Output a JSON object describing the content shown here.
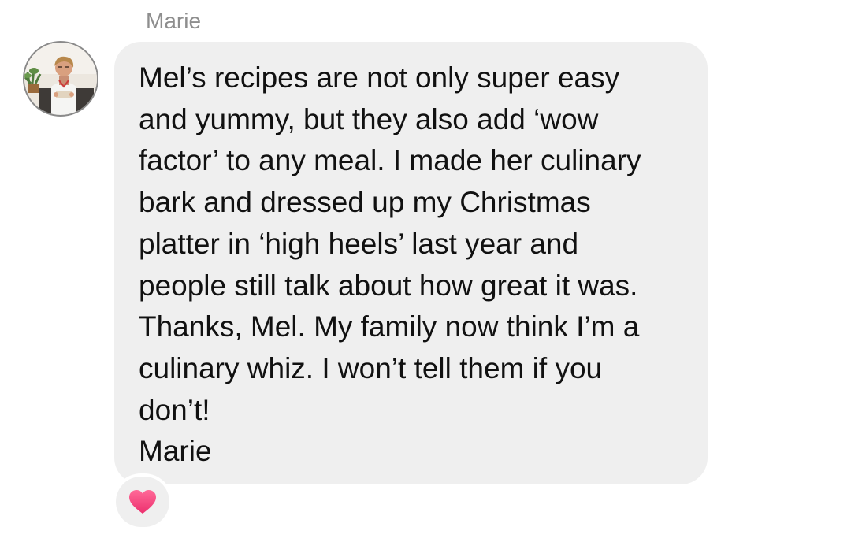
{
  "message": {
    "sender_name": "Marie",
    "text_lines": [
      "Mel’s recipes are not only super easy",
      "and yummy, but they also add ‘wow",
      "factor’ to any meal. I made her culinary",
      "bark and dressed up my Christmas",
      "platter in ‘high heels’ last year and",
      "people still talk about how great it was.",
      "Thanks, Mel. My family now think I’m a",
      "culinary whiz. I won’t tell them if you",
      "don’t!",
      "Marie"
    ],
    "reaction_icon": "pink-heart-icon",
    "avatar_icon": "profile-photo-avatar"
  },
  "colors": {
    "bubble_background": "#efefef",
    "text": "#111111",
    "sender_name": "#8e8e8e",
    "heart": "#f0427d"
  }
}
